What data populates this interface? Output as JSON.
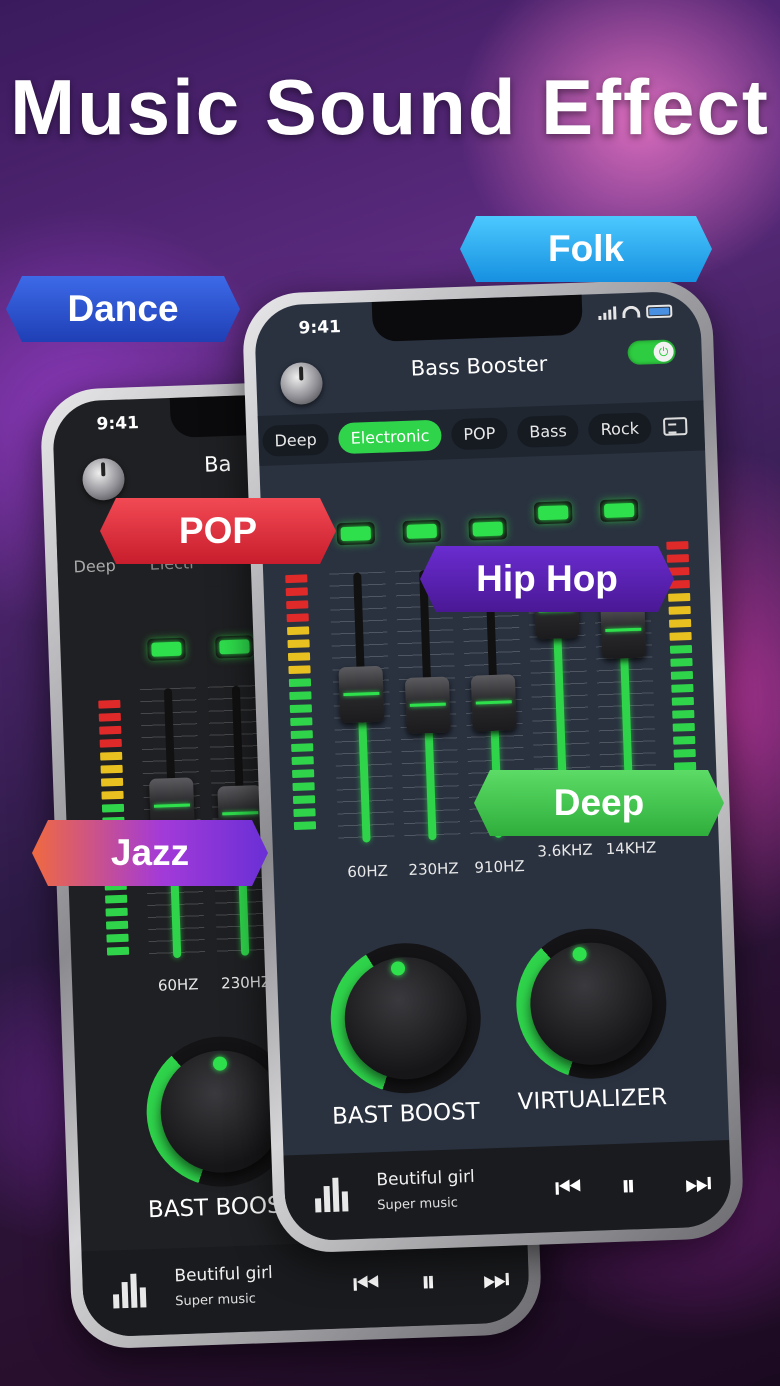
{
  "headline": "Music Sound Effect",
  "genre_tags": [
    {
      "label": "Folk",
      "color": "#1ea8f0"
    },
    {
      "label": "Dance",
      "color": "#2f55d4"
    },
    {
      "label": "POP",
      "color": "#e5303f"
    },
    {
      "label": "Hip Hop",
      "color": "#5b22b8"
    },
    {
      "label": "Jazz",
      "color": "#8b2fd8"
    },
    {
      "label": "Deep",
      "color": "#3fc050"
    }
  ],
  "front_phone": {
    "status_time": "9:41",
    "app_title": "Bass Booster",
    "presets": [
      "Deep",
      "Electronic",
      "POP",
      "Bass",
      "Rock"
    ],
    "active_preset": "Electronic",
    "bands": [
      {
        "label": "60HZ",
        "level": 0.55
      },
      {
        "label": "230HZ",
        "level": 0.5
      },
      {
        "label": "910HZ",
        "level": 0.5
      },
      {
        "label": "3.6KHZ",
        "level": 0.78
      },
      {
        "label": "14KHZ",
        "level": 0.7
      }
    ],
    "knobs": [
      {
        "label": "BAST BOOST",
        "level": 0.35
      },
      {
        "label": "VIRTUALIZER",
        "level": 0.3
      }
    ],
    "player": {
      "song": "Beutiful girl",
      "artist": "Super music"
    }
  },
  "back_phone": {
    "status_time": "9:41",
    "app_title": "Ba",
    "presets": [
      "Deep",
      "Electr"
    ],
    "bands": [
      {
        "label": "60HZ",
        "level": 0.55
      },
      {
        "label": "230HZ",
        "level": 0.5
      }
    ],
    "knob_label": "BAST BOOS",
    "player": {
      "song": "Beutiful girl",
      "artist": "Super music"
    }
  },
  "accent_color": "#2fd44b"
}
